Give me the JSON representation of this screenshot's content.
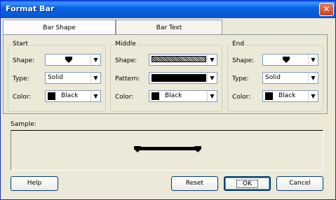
{
  "window": {
    "title": "Format Bar",
    "close_glyph": "✕"
  },
  "tabs": [
    {
      "label": "Bar Shape"
    },
    {
      "label": "Bar Text"
    }
  ],
  "start": {
    "group_label": "Start",
    "shape_label": "Shape:",
    "type_label": "Type:",
    "type_value": "Solid",
    "color_label": "Color:",
    "color_value": "Black"
  },
  "middle": {
    "group_label": "Middle",
    "shape_label": "Shape:",
    "pattern_label": "Pattern:",
    "color_label": "Color:",
    "color_value": "Black"
  },
  "end": {
    "group_label": "End",
    "shape_label": "Shape:",
    "type_label": "Type:",
    "type_value": "Solid",
    "color_label": "Color:",
    "color_value": "Black"
  },
  "sample": {
    "label": "Sample:"
  },
  "buttons": {
    "help": "Help",
    "reset": "Reset",
    "ok": "OK",
    "cancel": "Cancel"
  },
  "colors": {
    "titlebar": "#0a5bd6",
    "dialog_bg": "#ece9d8",
    "close": "#c8421d"
  },
  "icons": [
    "close-icon",
    "chevron-down-icon",
    "bar-shape-triangle-icon"
  ]
}
